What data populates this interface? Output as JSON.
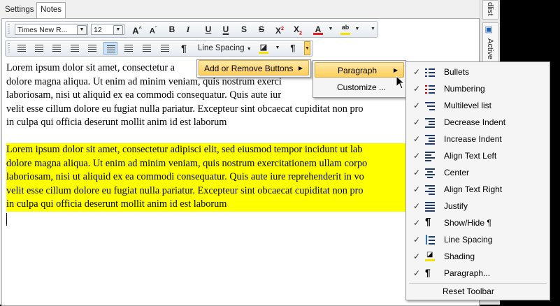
{
  "tabs": [
    {
      "label": "Settings"
    },
    {
      "label": "Notes"
    }
  ],
  "side_tabs": [
    {
      "label": "dlist"
    },
    {
      "label": "Active"
    }
  ],
  "toolbar1": {
    "font_name": "Times New R...",
    "font_size": "12",
    "grow_font": "A",
    "shrink_font": "A",
    "bold": "B",
    "italic": "I",
    "underline": "U",
    "double_underline": "U",
    "strike": "S",
    "double_strike": "S",
    "superscript": "X",
    "subscript": "X",
    "font_color": "A",
    "highlight": "ab"
  },
  "toolbar2": {
    "show_hide": "¶",
    "line_spacing_label": "Line Spacing"
  },
  "document": {
    "paragraph1": [
      "Lorem ipsum dolor sit amet, consectetur a",
      "dolore magna aliqua. Ut enim ad minim veniam, quis nostrum exerci",
      "laboriosam, nisi ut aliquid ex ea commodi consequatur. Quis aute iur",
      "velit esse cillum dolore eu fugiat nulla pariatur. Excepteur sint obcaecat cupiditat non pro",
      "in culpa qui officia deserunt mollit anim id est laborum"
    ],
    "paragraph2": [
      "Lorem ipsum dolor sit amet, consectetur adipisci elit, sed eiusmod tempor incidunt ut lab",
      "dolore magna aliqua. Ut enim ad minim veniam, quis nostrum exercitationem ullam corpo",
      "laboriosam, nisi ut aliquid ex ea commodi consequatur. Quis aute iure reprehenderit in vo",
      "velit esse cillum dolore eu fugiat nulla pariatur. Excepteur sint obcaecat cupiditat non pro",
      "in culpa qui officia deserunt mollit anim id est laborum"
    ],
    "highlight_color": "#ffff00"
  },
  "menu_add_remove": {
    "label": "Add or Remove Buttons"
  },
  "menu_level2": {
    "items": [
      {
        "label": "Paragraph"
      },
      {
        "label": "Customize ..."
      }
    ]
  },
  "menu_paragraph": {
    "items": [
      {
        "label": "Bullets",
        "checked": true,
        "icon": "bullets-icon"
      },
      {
        "label": "Numbering",
        "checked": true,
        "icon": "numbering-icon"
      },
      {
        "label": "Multilevel list",
        "checked": true,
        "icon": "multilevel-list-icon"
      },
      {
        "label": "Decrease Indent",
        "checked": true,
        "icon": "decrease-indent-icon"
      },
      {
        "label": "Increase Indent",
        "checked": true,
        "icon": "increase-indent-icon"
      },
      {
        "label": "Align Text Left",
        "checked": true,
        "icon": "align-left-icon"
      },
      {
        "label": "Center",
        "checked": true,
        "icon": "align-center-icon"
      },
      {
        "label": "Align Text Right",
        "checked": true,
        "icon": "align-right-icon"
      },
      {
        "label": "Justify",
        "checked": true,
        "icon": "justify-icon"
      },
      {
        "label": "Show/Hide ¶",
        "checked": true,
        "icon": "pilcrow-icon"
      },
      {
        "label": "Line Spacing",
        "checked": true,
        "icon": "line-spacing-icon"
      },
      {
        "label": "Shading",
        "checked": true,
        "icon": "shading-icon"
      },
      {
        "label": "Paragraph...",
        "checked": true,
        "icon": "paragraph-settings-icon"
      }
    ],
    "reset_label": "Reset Toolbar"
  },
  "colors": {
    "accent_hot": "#ffcf5c",
    "font_color_bar": "#e02020",
    "highlight_bar": "#f4e100",
    "icon_blue": "#1f3a6e"
  }
}
